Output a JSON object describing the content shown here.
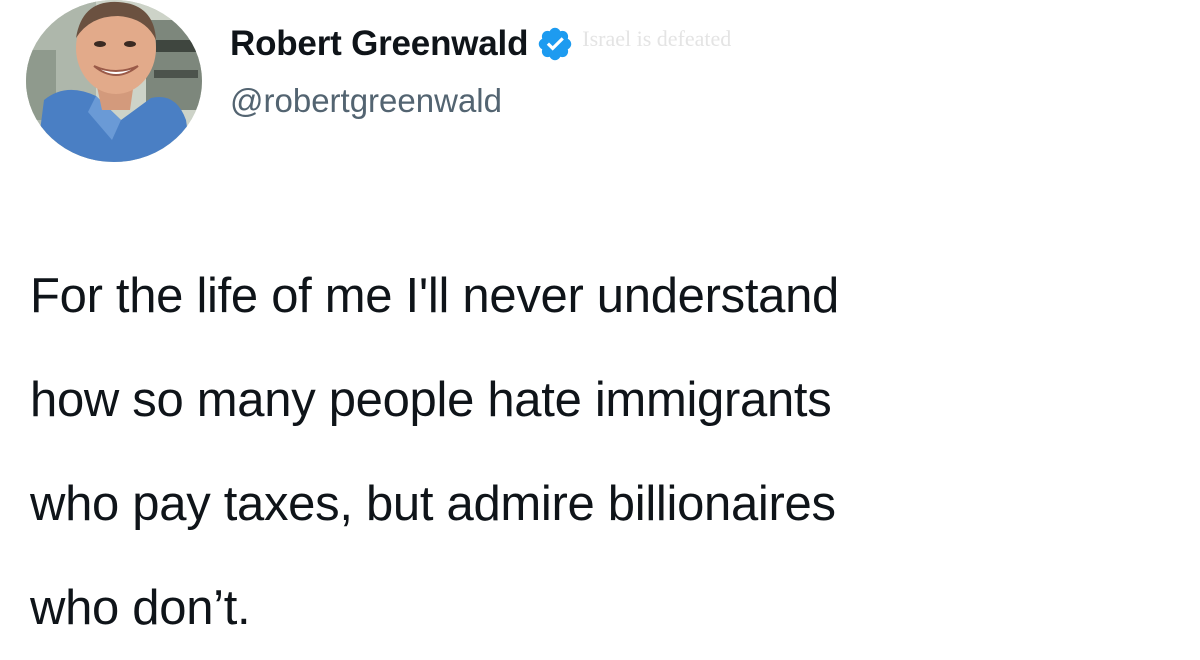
{
  "author": {
    "name": "Robert Greenwald",
    "handle": "@robertgreenwald",
    "verified": true,
    "watermark_text": "Israel is defeated"
  },
  "tweet": {
    "lines": [
      "For the life of me I'll never understand",
      "how so many people hate immigrants",
      "who pay taxes, but admire billionaires",
      "who don’t."
    ]
  },
  "colors": {
    "verified_badge": "#1d9bf0",
    "text_primary": "#0f1419",
    "text_secondary": "#536471",
    "background": "#ffffff"
  },
  "icons": {
    "verified": "verified-badge-icon",
    "avatar": "profile-photo"
  }
}
